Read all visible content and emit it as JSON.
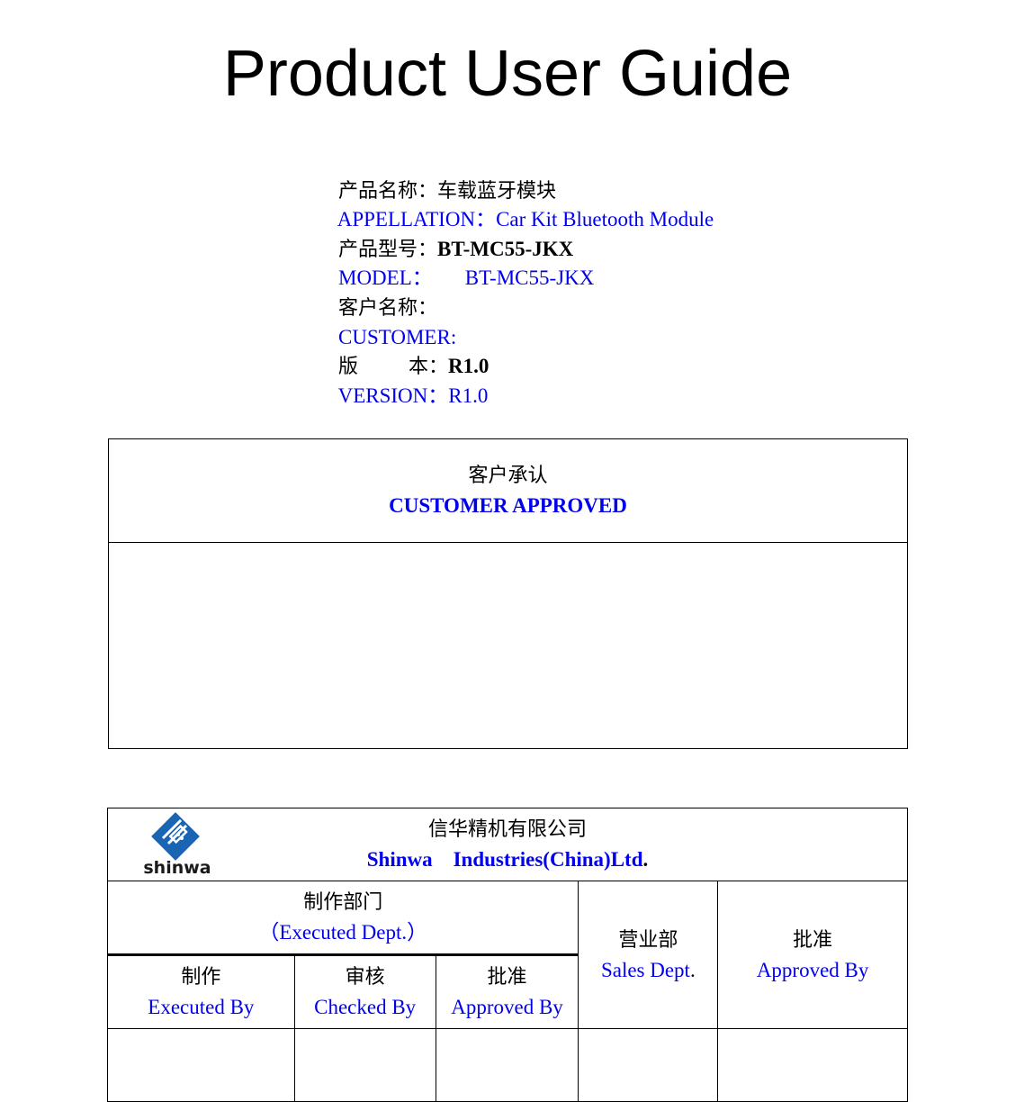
{
  "document": {
    "title": "Product User Guide"
  },
  "info": {
    "name_zh_label": "产品名称：",
    "name_zh_value": "车载蓝牙模块",
    "appellation_label": "APPELLATION：",
    "appellation_value": "Car Kit Bluetooth Module",
    "model_zh_label": "产品型号：",
    "model_zh_value": "BT-MC55-JKX",
    "model_label": "MODEL：",
    "model_value": "BT-MC55-JKX",
    "customer_zh_label": "客户名称：",
    "customer_label": "CUSTOMER:",
    "version_zh_label": "版        本：",
    "version_zh_value": "R1.0",
    "version_label": "VERSION：",
    "version_value": "R1.0"
  },
  "approval": {
    "title_zh": "客户承认",
    "title_en": "CUSTOMER APPROVED"
  },
  "company": {
    "logo_text": "shinwa",
    "name_zh": "信华精机有限公司",
    "name_en": "Shinwa    Industries(China)Ltd",
    "name_en_suffix": "."
  },
  "signoff": {
    "executed_dept_zh": "制作部门",
    "executed_dept_en": "（Executed Dept.）",
    "sales_zh": "营业部",
    "sales_en": "Sales Dept",
    "sales_suffix": ".",
    "approved_zh": "批准",
    "approved_en": "Approved By",
    "columns": [
      {
        "zh": "制作",
        "en": "Executed By"
      },
      {
        "zh": "审核",
        "en": "Checked By"
      },
      {
        "zh": "批准",
        "en": "Approved By"
      }
    ]
  },
  "colors": {
    "accent_blue": "#0000ee",
    "logo_blue": "#1a64b4"
  }
}
